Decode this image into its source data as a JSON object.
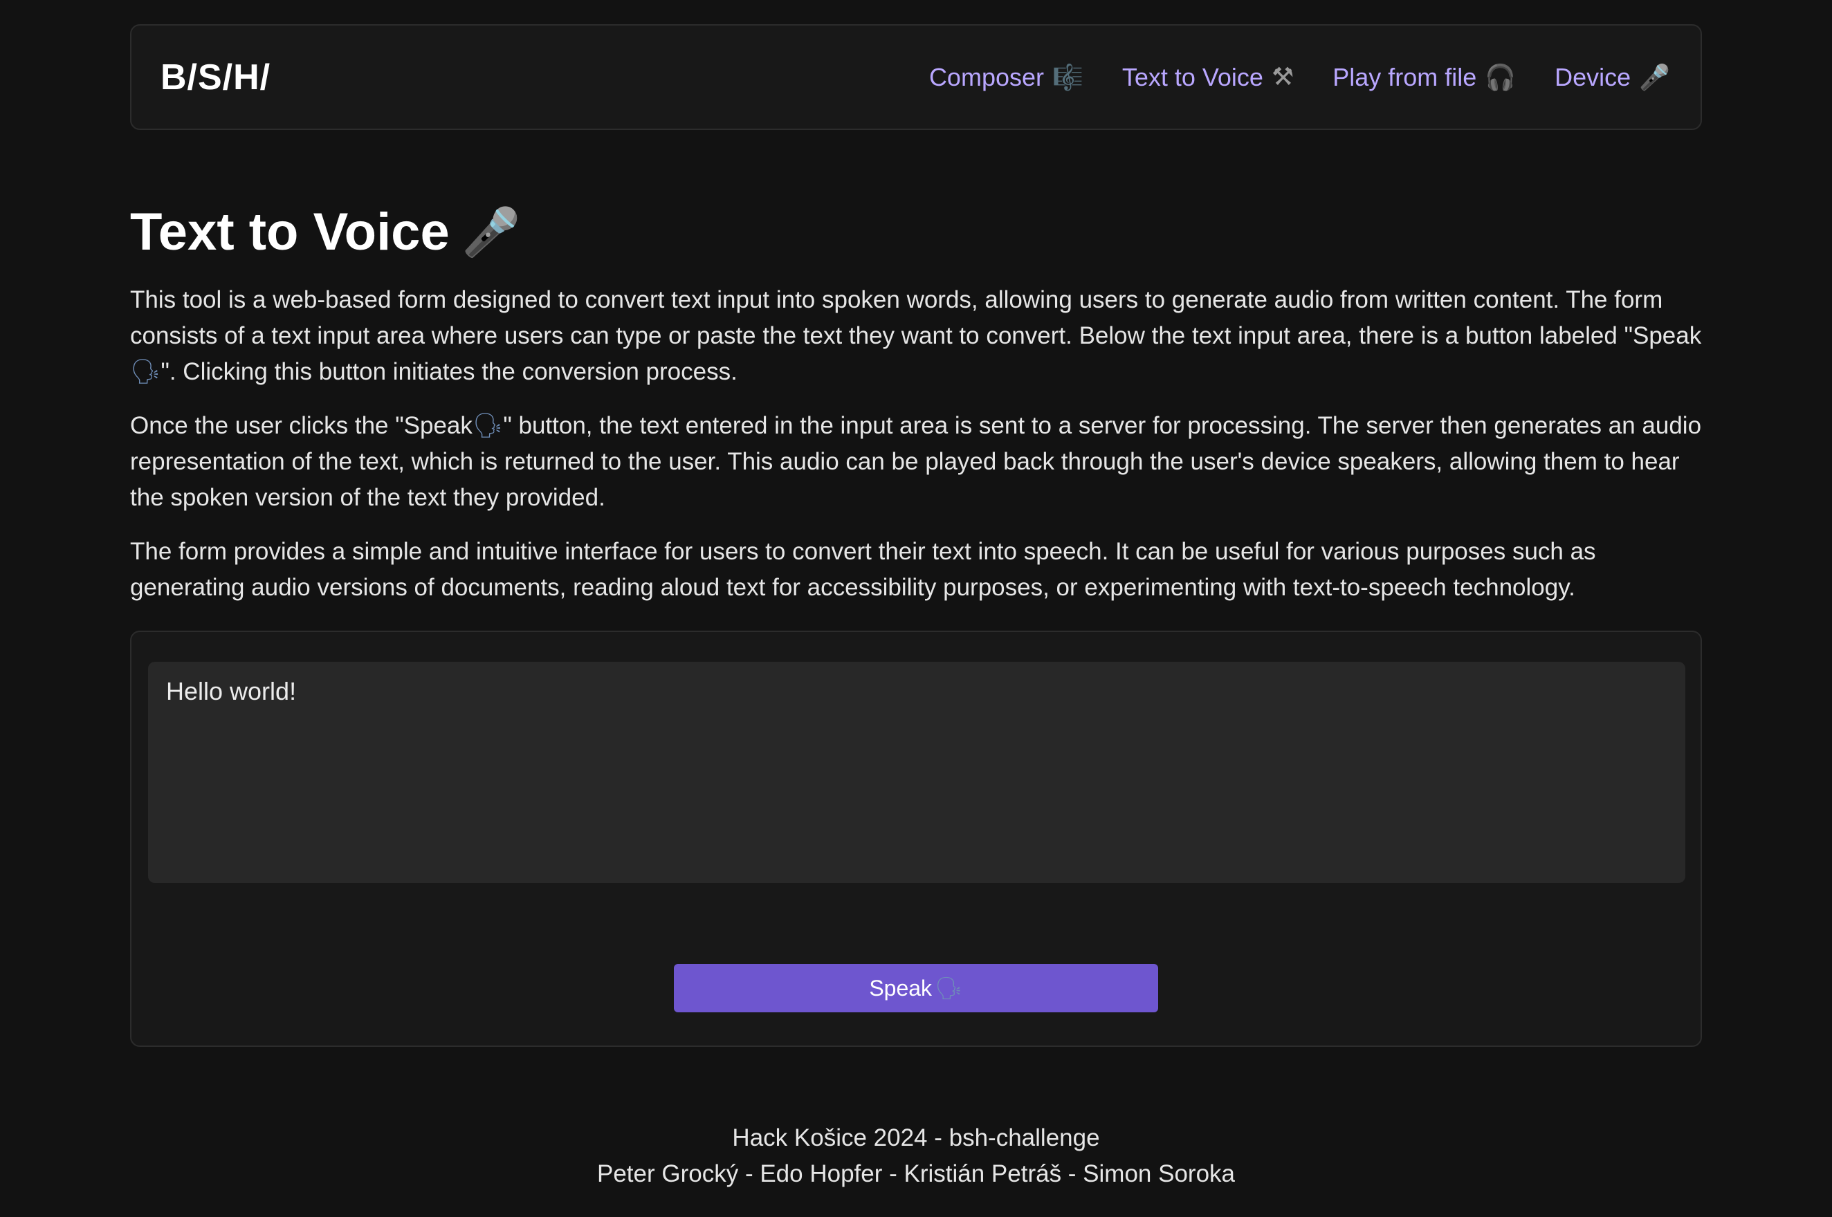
{
  "header": {
    "brand": "B/S/H/",
    "nav": [
      {
        "label": "Composer",
        "icon": "🎼",
        "icon_name": "sheet-music-icon"
      },
      {
        "label": "Text to Voice",
        "icon": "⚒",
        "icon_name": "hammer-and-pick-icon"
      },
      {
        "label": "Play from file",
        "icon": "🎧",
        "icon_name": "headphones-icon"
      },
      {
        "label": "Device",
        "icon": "🎤",
        "icon_name": "microphone-icon"
      }
    ]
  },
  "main": {
    "title": "Text to Voice",
    "title_icon": "🎤",
    "paragraphs": {
      "p1_a": "This tool is a web-based form designed to convert text input into spoken words, allowing users to generate audio from written content. The form consists of a text input area where users can type or paste the text they want to convert. Below the text input area, there is a button labeled \"Speak",
      "p1_b": "\". Clicking this button initiates the conversion process.",
      "p2_a": "Once the user clicks the \"Speak",
      "p2_b": "\" button, the text entered in the input area is sent to a server for processing. The server then generates an audio representation of the text, which is returned to the user. This audio can be played back through the user's device speakers, allowing them to hear the spoken version of the text they provided.",
      "p3": "The form provides a simple and intuitive interface for users to convert their text into speech. It can be useful for various purposes such as generating audio versions of documents, reading aloud text for accessibility purposes, or experimenting with text-to-speech technology."
    },
    "speak_emoji": "🗣",
    "form": {
      "text_value": "Hello world!",
      "speak_label": "Speak"
    }
  },
  "footer": {
    "line1": "Hack Košice 2024 - bsh-challenge",
    "line2": "Peter Grocký - Edo Hopfer - Kristián Petráš - Simon Soroka"
  },
  "colors": {
    "background": "#121212",
    "card": "#181818",
    "accent": "#6e56cf",
    "link": "#b9a7ff"
  }
}
